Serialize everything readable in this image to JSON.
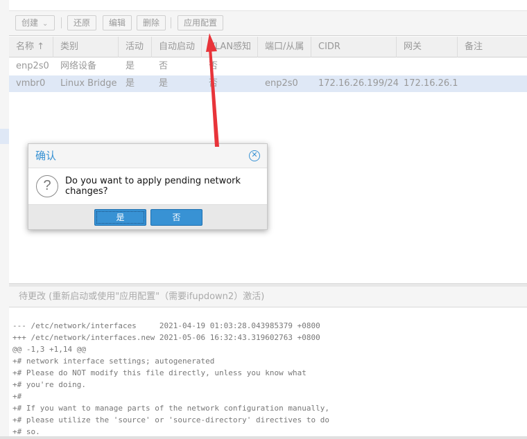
{
  "toolbar": {
    "create_label": "创建",
    "revert_label": "还原",
    "edit_label": "编辑",
    "remove_label": "删除",
    "apply_label": "应用配置"
  },
  "grid": {
    "columns": [
      "名称 ↑",
      "类别",
      "活动",
      "自动启动",
      "VLAN感知",
      "端口/从属",
      "CIDR",
      "网关",
      "备注"
    ],
    "rows": [
      {
        "name": "enp2s0",
        "type": "网络设备",
        "active": "是",
        "autostart": "否",
        "vlan": "否",
        "ports": "",
        "cidr": "",
        "gateway": "",
        "comment": ""
      },
      {
        "name": "vmbr0",
        "type": "Linux Bridge",
        "active": "是",
        "autostart": "是",
        "vlan": "否",
        "ports": "enp2s0",
        "cidr": "172.16.26.199/24",
        "gateway": "172.16.26.1",
        "comment": ""
      }
    ]
  },
  "pending": {
    "title": "待更改 (重新启动或使用\"应用配置\"（需要ifupdown2）激活)",
    "diff_lines": [
      "--- /etc/network/interfaces     2021-04-19 01:03:28.043985379 +0800",
      "+++ /etc/network/interfaces.new 2021-05-06 16:32:43.319602763 +0800",
      "@@ -1,3 +1,14 @@",
      "+# network interface settings; autogenerated",
      "+# Please do NOT modify this file directly, unless you know what",
      "+# you're doing.",
      "+#",
      "+# If you want to manage parts of the network configuration manually,",
      "+# please utilize the 'source' or 'source-directory' directives to do",
      "+# so."
    ]
  },
  "dialog": {
    "title": "确认",
    "message": "Do you want to apply pending network changes?",
    "yes_label": "是",
    "no_label": "否"
  },
  "colors": {
    "accent": "#3892d4",
    "arrow": "#e8343a",
    "selected_row": "#dfe8f6"
  }
}
